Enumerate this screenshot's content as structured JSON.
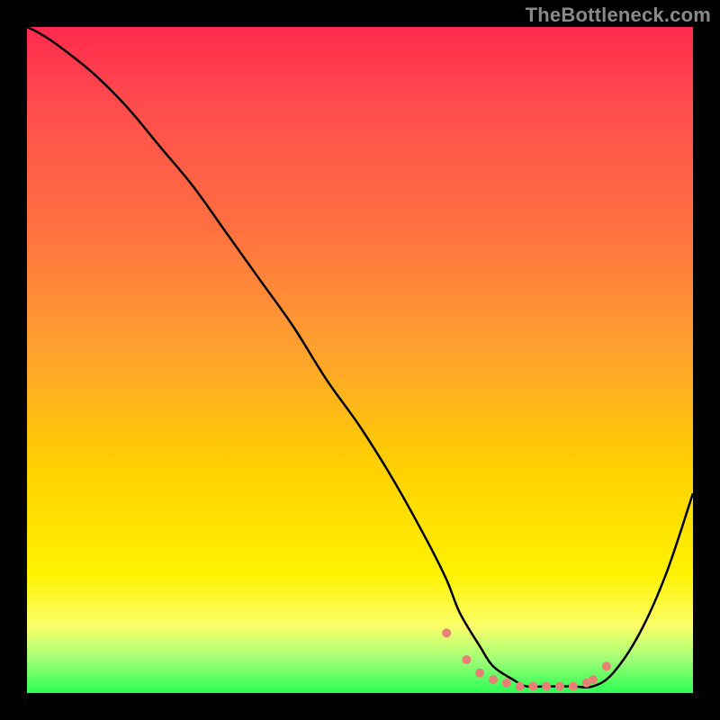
{
  "watermark": "TheBottleneck.com",
  "colors": {
    "background": "#000000",
    "gradient_stops": [
      "#ff2a4d",
      "#ff4d4d",
      "#ff7040",
      "#ffa030",
      "#ffd000",
      "#fff200",
      "#fbff6b",
      "#9fff75",
      "#2bff55"
    ],
    "curve": "#000000",
    "markers": "#e98078"
  },
  "chart_data": {
    "type": "line",
    "title": "",
    "xlabel": "",
    "ylabel": "",
    "xlim": [
      0,
      100
    ],
    "ylim": [
      0,
      100
    ],
    "grid": false,
    "legend": null,
    "series": [
      {
        "name": "bottleneck-curve",
        "x": [
          0,
          2,
          5,
          10,
          15,
          20,
          25,
          30,
          35,
          40,
          45,
          50,
          55,
          60,
          63,
          65,
          68,
          70,
          73,
          75,
          78,
          80,
          82,
          85,
          88,
          92,
          96,
          100
        ],
        "y": [
          100,
          99,
          97,
          93,
          88,
          82,
          76,
          69,
          62,
          55,
          47,
          40,
          32,
          23,
          17,
          12,
          7,
          4,
          2,
          1,
          1,
          1,
          1,
          1,
          3,
          9,
          18,
          30
        ]
      }
    ],
    "markers": {
      "name": "highlight-dots",
      "x": [
        63,
        66,
        68,
        70,
        72,
        74,
        76,
        78,
        80,
        82,
        84,
        85,
        87
      ],
      "y": [
        9,
        5,
        3,
        2,
        1.5,
        1,
        1,
        1,
        1,
        1,
        1.5,
        2,
        4
      ]
    }
  }
}
